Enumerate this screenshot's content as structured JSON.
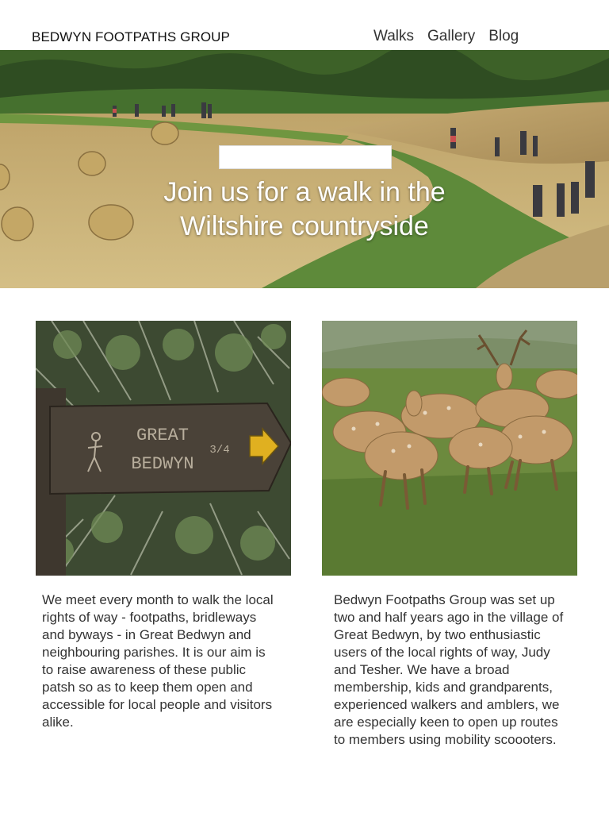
{
  "site": {
    "title": "BEDWYN FOOTPATHS GROUP"
  },
  "nav": {
    "items": [
      "Walks",
      "Gallery",
      "Blog"
    ]
  },
  "hero": {
    "heading": "Join us for a walk in the\nWiltshire countryside"
  },
  "photos": {
    "left": {
      "sign_line1": "GREAT",
      "sign_line2": "BEDWYN",
      "sign_fraction": "3/4"
    }
  },
  "columns": [
    {
      "text": "We meet every month to walk the local\nrights of way - footpaths, bridleways\nand byways - in Great Bedwyn and\nneighbouring parishes.  It is our aim is\nto raise awareness of these public\npatsh so as to keep them open and\naccessible for local people and visitors\nalike."
    },
    {
      "text": "Bedwyn Footpaths Group was set up\ntwo and half years ago in the village of\nGreat Bedwyn, by two enthusiastic\nusers of the local rights of way, Judy\nand Tesher.  We have a broad\nmembership, kids and grandparents,\nexperienced walkers and amblers, we\nare especially keen to open up routes\nto members using mobility scoooters."
    }
  ],
  "colors": {
    "hero_field": "#c9b37a",
    "hero_grass": "#5e8a3a",
    "trees": "#2f4d22",
    "sign_wood": "#4a4238",
    "sign_arrow": "#e0b020",
    "deer": "#c29a6a"
  }
}
